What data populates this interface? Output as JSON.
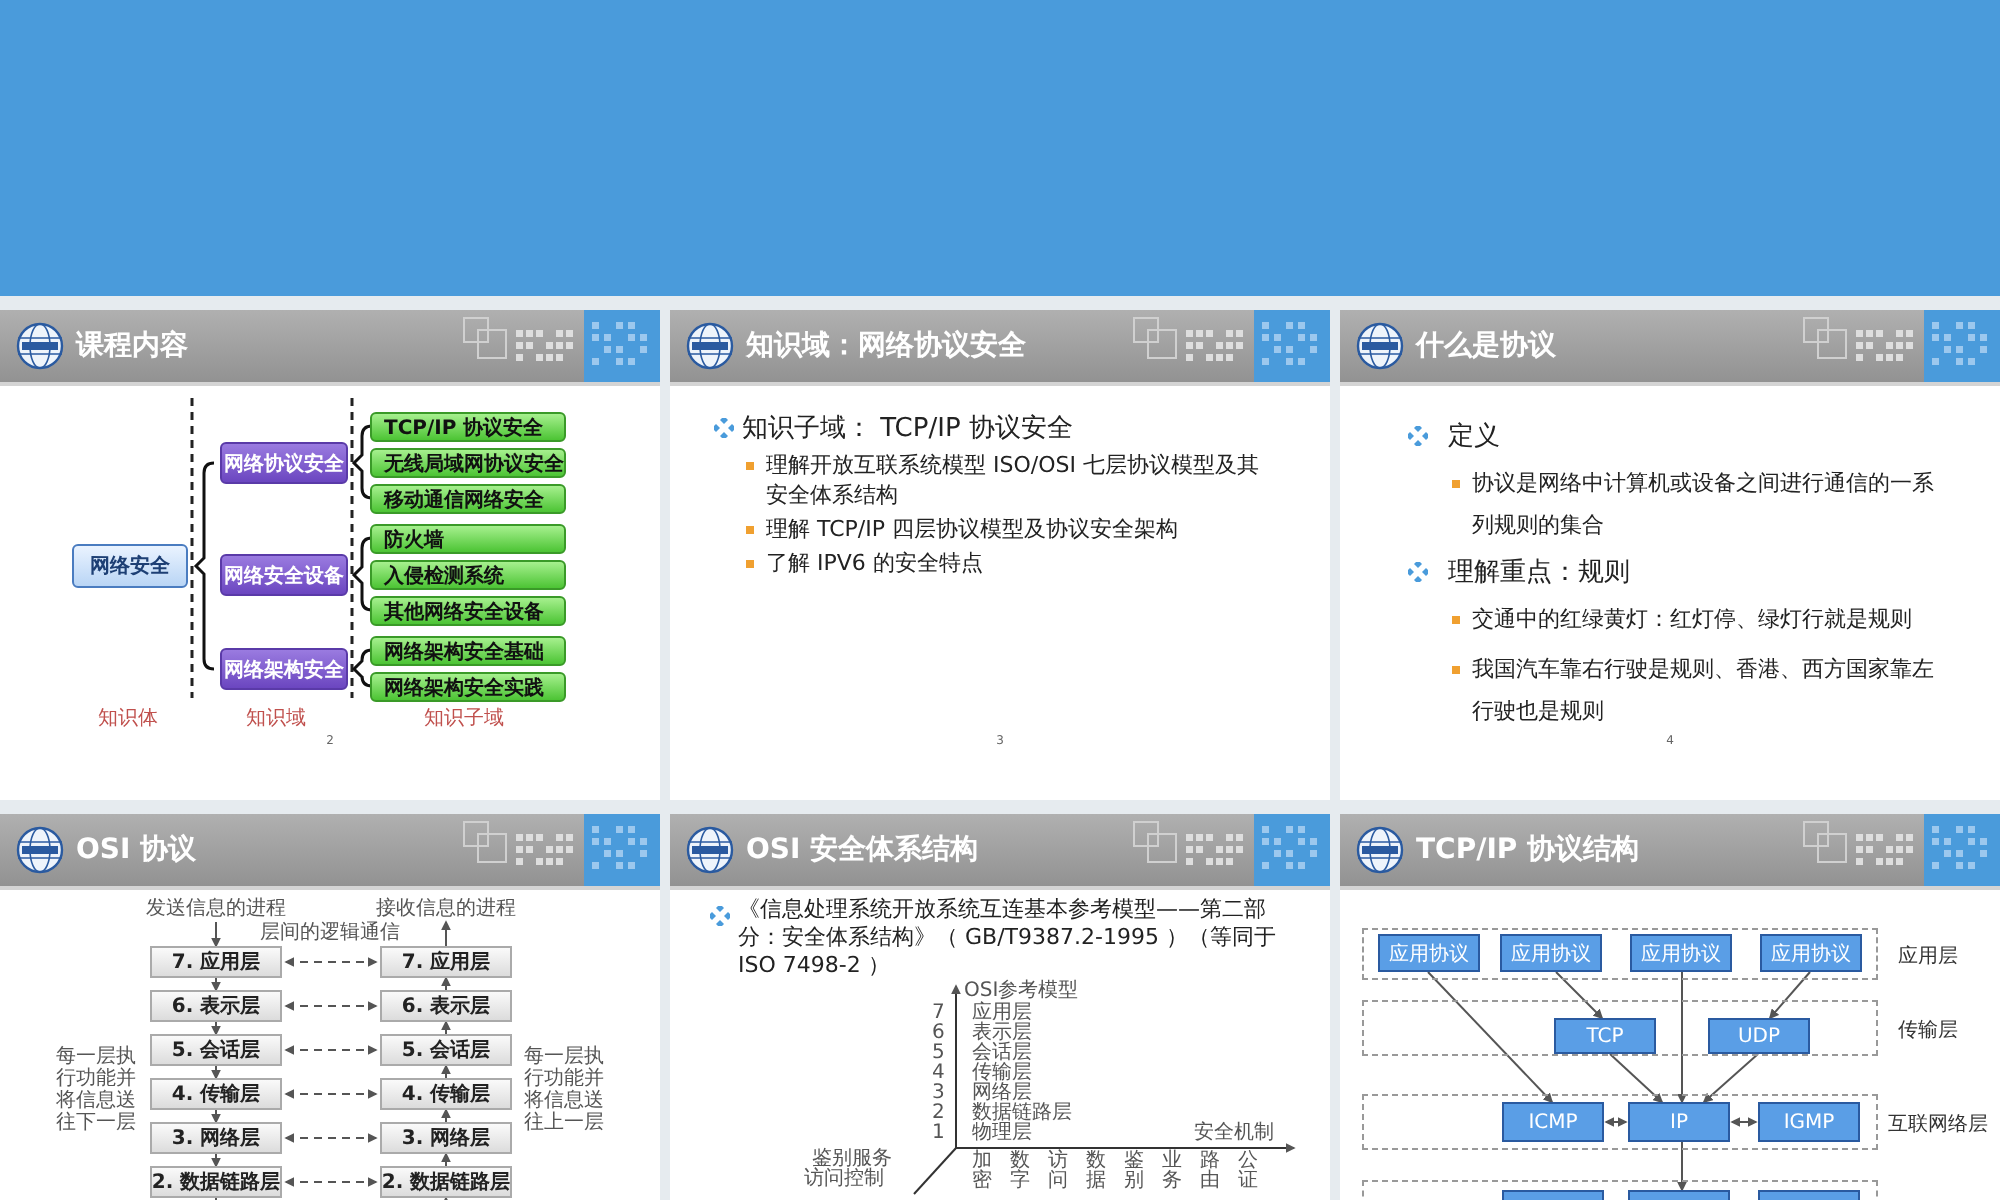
{
  "slides": [
    {
      "kind": "blank"
    },
    {
      "kind": "tree",
      "title": "课程内容",
      "page": "2",
      "root": "网络安全",
      "domains": [
        {
          "label": "网络协议安全",
          "children": [
            "TCP/IP 协议安全",
            "无线局域网协议安全",
            "移动通信网络安全"
          ]
        },
        {
          "label": "网络安全设备",
          "children": [
            "防火墙",
            "入侵检测系统",
            "其他网络安全设备"
          ]
        },
        {
          "label": "网络架构安全",
          "children": [
            "网络架构安全基础",
            "网络架构安全实践"
          ]
        }
      ],
      "captions": [
        "知识体",
        "知识域",
        "知识子域"
      ]
    },
    {
      "kind": "bullets",
      "title": "知识域：网络协议安全",
      "page": "3",
      "items": [
        {
          "text": "知识子域： TCP/IP 协议安全",
          "children": [
            {
              "text": "理解开放互联系统模型 ISO/OSI 七层协议模型及其安全体系结构"
            },
            {
              "text": "理解 TCP/IP 四层协议模型及协议安全架构"
            },
            {
              "text": "了解 IPV6 的安全特点"
            }
          ]
        }
      ]
    },
    {
      "kind": "definition",
      "title": "什么是协议",
      "page": "4",
      "items": [
        {
          "text": "定义",
          "children": [
            {
              "text": "协议是网络中计算机或设备之间进行通信的一系列规则的集合"
            }
          ]
        },
        {
          "text": "理解重点：规则",
          "children": [
            {
              "text": "交通中的红绿黄灯：红灯停、绿灯行就是规则"
            },
            {
              "text": "我国汽车靠右行驶是规则、香港、西方国家靠左行驶也是规则"
            }
          ]
        }
      ]
    },
    {
      "kind": "osi",
      "title": "OSI 协议",
      "sender": "发送信息的进程",
      "receiver": "接收信息的进程",
      "peer_label": "层间的逻辑通信",
      "left_note": "每一层执行功能并将信息送往下一层",
      "right_note": "每一层执行功能并将信息送往上一层",
      "layers": [
        {
          "left": "7. 应用层",
          "right": "7. 应用层"
        },
        {
          "left": "6. 表示层",
          "right": "6. 表示层"
        },
        {
          "left": "5. 会话层",
          "right": "5. 会话层"
        },
        {
          "left": "4. 传输层",
          "right": "4. 传输层"
        },
        {
          "left": "3. 网络层",
          "right": "3. 网络层"
        },
        {
          "left": "2. 数据链路层",
          "right": "2. 数据链路层"
        }
      ]
    },
    {
      "kind": "osi_security",
      "title": "OSI 安全体系结构",
      "text": "《信息处理系统开放系统互连基本参考模型——第二部分：安全体系结构》（ GB/T9387.2-1995 ）（等同于 ISO 7498-2 ）",
      "axis_title": "OSI参考模型",
      "layers": [
        {
          "number": "7",
          "name": "应用层"
        },
        {
          "number": "6",
          "name": "表示层"
        },
        {
          "number": "5",
          "name": "会话层"
        },
        {
          "number": "4",
          "name": "传输层"
        },
        {
          "number": "3",
          "name": "网络层"
        },
        {
          "number": "2",
          "name": "数据链路层"
        },
        {
          "number": "1",
          "name": "物理层"
        }
      ],
      "mechanism_axis": "安全机制",
      "mechanisms": [
        "加密",
        "数字",
        "访问",
        "数据",
        "鉴别",
        "业务",
        "路由",
        "公证"
      ],
      "services": [
        "鉴别服务",
        "访问控制"
      ]
    },
    {
      "kind": "tcpip",
      "title": "TCP/IP 协议结构",
      "rows": [
        {
          "label": "应用层",
          "boxes": [
            "应用协议",
            "应用协议",
            "应用协议",
            "应用协议"
          ]
        },
        {
          "label": "传输层",
          "boxes": [
            "TCP",
            "UDP"
          ]
        },
        {
          "label": "互联网络层",
          "boxes": [
            "ICMP",
            "IP",
            "IGMP"
          ]
        }
      ]
    }
  ]
}
